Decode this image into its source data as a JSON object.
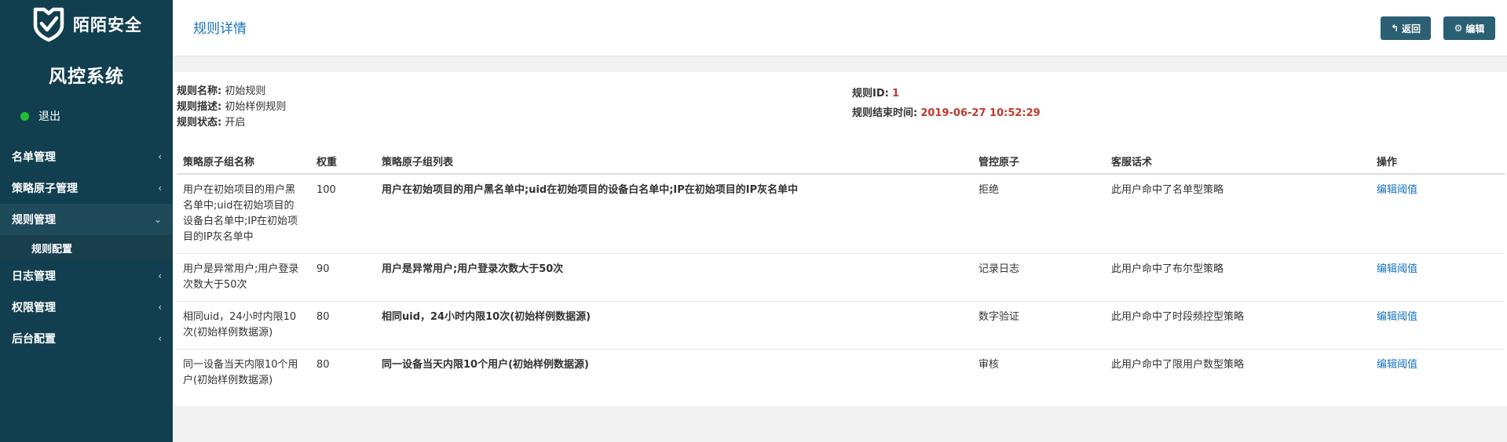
{
  "brand": {
    "name": "陌陌安全",
    "logo_icon": "shield-check-icon"
  },
  "system_title": "风控系统",
  "user": {
    "status_color": "#22c232",
    "logout_label": "退出"
  },
  "sidebar": {
    "items": [
      {
        "label": "名单管理",
        "chevron": "‹"
      },
      {
        "label": "策略原子管理",
        "chevron": "‹"
      },
      {
        "label": "规则管理",
        "chevron": "⌄",
        "children": [
          {
            "label": "规则配置"
          }
        ]
      },
      {
        "label": "日志管理",
        "chevron": "‹"
      },
      {
        "label": "权限管理",
        "chevron": "‹"
      },
      {
        "label": "后台配置",
        "chevron": "‹"
      }
    ]
  },
  "header": {
    "title": "规则详情",
    "back_label": "返回",
    "back_icon": "↰",
    "edit_label": "编辑",
    "edit_icon": "⚙"
  },
  "rule": {
    "name_label": "规则名称:",
    "name": "初始规则",
    "desc_label": "规则描述:",
    "desc": "初始样例规则",
    "status_label": "规则状态:",
    "status": "开启",
    "id_label": "规则ID:",
    "id": "1",
    "end_time_label": "规则结束时间:",
    "end_time": "2019-06-27 10:52:29"
  },
  "table": {
    "headers": [
      "策略原子组名称",
      "权重",
      "策略原子组列表",
      "管控原子",
      "客服话术",
      "操作"
    ],
    "rows": [
      {
        "name": "用户在初始项目的用户黑名单中;uid在初始项目的设备白名单中;IP在初始项目的IP灰名单中",
        "weight": "100",
        "list": "用户在初始项目的用户黑名单中;uid在初始项目的设备白名单中;IP在初始项目的IP灰名单中",
        "control": "拒绝",
        "script": "此用户命中了名单型策略",
        "action": "编辑阈值"
      },
      {
        "name": "用户是异常用户;用户登录次数大于50次",
        "weight": "90",
        "list": "用户是异常用户;用户登录次数大于50次",
        "control": "记录日志",
        "script": "此用户命中了布尔型策略",
        "action": "编辑阈值"
      },
      {
        "name": "相同uid，24小时内限10次(初始样例数据源)",
        "weight": "80",
        "list": "相同uid，24小时内限10次(初始样例数据源)",
        "control": "数字验证",
        "script": "此用户命中了时段频控型策略",
        "action": "编辑阈值"
      },
      {
        "name": "同一设备当天内限10个用户(初始样例数据源)",
        "weight": "80",
        "list": "同一设备当天内限10个用户(初始样例数据源)",
        "control": "审核",
        "script": "此用户命中了限用户数型策略",
        "action": "编辑阈值"
      }
    ]
  },
  "colors": {
    "sidebar_bg": "#123f4f",
    "accent_blue": "#1a73b8",
    "accent_red": "#c0392b",
    "button_bg": "#2b5f73"
  }
}
